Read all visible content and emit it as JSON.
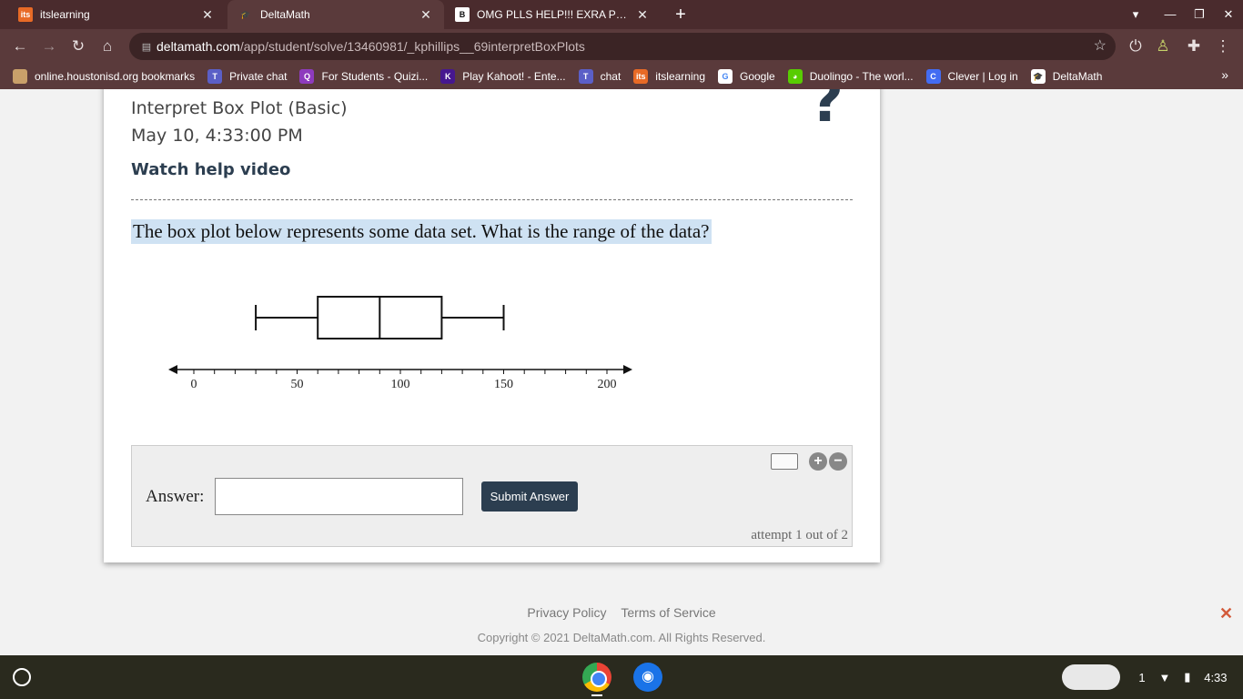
{
  "browser": {
    "tabs": [
      {
        "title": "itslearning",
        "favicon": "its",
        "favicon_color": "#e86a26"
      },
      {
        "title": "DeltaMath",
        "favicon": "🎓",
        "favicon_color": "#5a3a3b"
      },
      {
        "title": "OMG PLLS HELP!!! EXRA POINTS",
        "favicon": "B",
        "favicon_color": "#111111"
      }
    ],
    "url_host": "deltamath.com",
    "url_path": "/app/student/solve/13460981/_kphillips__69interpretBoxPlots",
    "bookmarks": [
      {
        "label": "online.houstonisd.org bookmarks",
        "icon": "folder-icon",
        "color": "#c9a06a"
      },
      {
        "label": "Private chat",
        "icon": "teams-icon",
        "color": "#5b5fc7"
      },
      {
        "label": "For Students - Quizi...",
        "icon": "quizizz-icon",
        "color": "#8e3bbd"
      },
      {
        "label": "Play Kahoot! - Ente...",
        "icon": "kahoot-icon",
        "color": "#46178f"
      },
      {
        "label": "chat",
        "icon": "teams-icon",
        "color": "#5b5fc7"
      },
      {
        "label": "itslearning",
        "icon": "its-icon",
        "color": "#e86a26"
      },
      {
        "label": "Google",
        "icon": "google-icon",
        "color": "#ffffff"
      },
      {
        "label": "Duolingo - The worl...",
        "icon": "duolingo-icon",
        "color": "#58cc02"
      },
      {
        "label": "Clever | Log in",
        "icon": "clever-icon",
        "color": "#436cf2"
      },
      {
        "label": "DeltaMath",
        "icon": "deltamath-icon",
        "color": "#ffffff"
      }
    ]
  },
  "problem": {
    "title": "Interpret Box Plot (Basic)",
    "date": "May 10, 4:33:00 PM",
    "help_link": "Watch help video",
    "help_icon": "?",
    "question": "The box plot below represents some data set. What is the range of the data?"
  },
  "chart_data": {
    "type": "boxplot",
    "min": 30,
    "q1": 60,
    "median": 90,
    "q3": 120,
    "max": 150,
    "axis_min": 0,
    "axis_max": 200,
    "minor_tick_step": 10,
    "major_labels": [
      0,
      50,
      100,
      150,
      200
    ]
  },
  "answer": {
    "label": "Answer:",
    "value": "",
    "submit_label": "Submit Answer",
    "attempt_text": "attempt 1 out of 2"
  },
  "footer": {
    "privacy": "Privacy Policy",
    "terms": "Terms of Service",
    "copyright": "Copyright © 2021 DeltaMath.com. All Rights Reserved."
  },
  "system": {
    "notification_count": "1",
    "clock": "4:33"
  }
}
